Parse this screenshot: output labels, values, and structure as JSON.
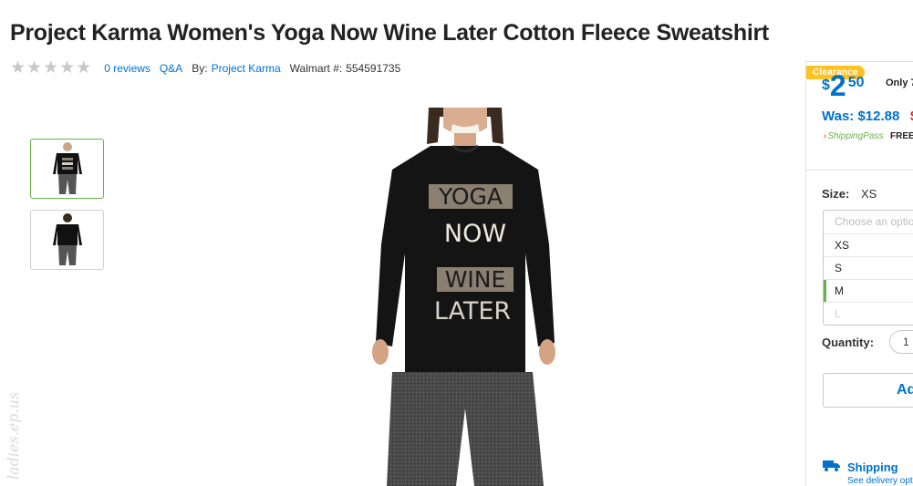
{
  "product": {
    "title": "Project Karma Women's Yoga Now Wine Later Cotton Fleece Sweatshirt",
    "rating_stars": 5,
    "reviews_link": "0 reviews",
    "qa_link": "Q&A",
    "by_label": "By:",
    "brand_link": "Project Karma",
    "walmart_label": "Walmart #:",
    "walmart_number": "554591735"
  },
  "gallery": {
    "thumbnails": [
      "front-view",
      "back-view"
    ],
    "active_index": 0,
    "shirt_text": [
      "YOGA",
      "NOW",
      "WINE",
      "LATER"
    ]
  },
  "watermark": {
    "text": "ladies.ep.us"
  },
  "buybox": {
    "badge": "Clearance",
    "price_symbol": "$",
    "price_whole": "2",
    "price_cents": "50",
    "only_text": "Only 7",
    "was_text": "Was: $12.88",
    "was_strike": "$",
    "shipping_pass": "ShippingPass",
    "shipping_pass_mark": "›",
    "free_text": "FREE",
    "size_label": "Size:",
    "size_value": "XS",
    "size_options": [
      "Choose an option",
      "XS",
      "S",
      "M",
      "L"
    ],
    "quantity_label": "Quantity:",
    "quantity_value": "1",
    "add_button": "Ad",
    "shipping_title": "Shipping",
    "shipping_sub": "See delivery opt"
  },
  "colors": {
    "brand_blue": "#0071ce",
    "clearance_yellow": "#ffc220",
    "accent_green": "#6ab04c",
    "sale_red": "#de1c24"
  }
}
